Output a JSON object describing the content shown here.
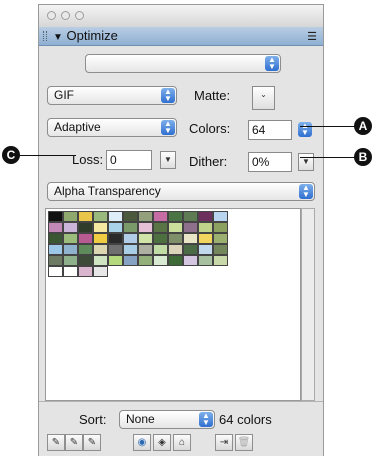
{
  "panel": {
    "tab_title": "Optimize",
    "menu_icon": "panel-menu-icon"
  },
  "settings": {
    "preset_value": "",
    "format_value": "GIF",
    "matte_label": "Matte:",
    "palette_value": "Adaptive",
    "colors_label": "Colors:",
    "colors_value": "64",
    "loss_label": "Loss:",
    "loss_value": "0",
    "dither_label": "Dither:",
    "dither_value": "0%",
    "transparency_value": "Alpha Transparency"
  },
  "callouts": {
    "a": "A",
    "b": "B",
    "c": "C"
  },
  "footer": {
    "sort_label": "Sort:",
    "sort_value": "None",
    "color_count": "64 colors"
  },
  "swatches": [
    [
      "#111111",
      "#8fa86e",
      "#e9c54a",
      "#9ab97c",
      "#ddeef6",
      "#4b5a3c",
      "#93a07b",
      "#c46ca3",
      "#4a7443",
      "#5e7b54",
      "#6d2f5d",
      "#b8d4ee"
    ],
    [
      "#c389b6",
      "#cbb5d8",
      "#2f3b2b",
      "#f3e7a1",
      "#a8d3e9",
      "#7a9a69",
      "#e6c0d6",
      "#5a7545",
      "#c9df9a",
      "#8e6f8c",
      "#bfd48a",
      "#8ca060"
    ],
    [
      "#3b5633",
      "#9bbc7b",
      "#b85b93",
      "#f0cc43",
      "#2a2a2a",
      "#b0cce6",
      "#d1e4a7",
      "#4e7040",
      "#7f8f6a",
      "#e8e6c6",
      "#f2d55f",
      "#9bb070"
    ],
    [
      "#9cc7e6",
      "#8fb3cf",
      "#5f8a5a",
      "#dcd7b0",
      "#6f6f6f",
      "#a8cfe5",
      "#aeb0a1",
      "#c1dca5",
      "#dad5ba",
      "#4a6b46",
      "#c2d8ec",
      "#74865c"
    ],
    [
      "#6c7b62",
      "#8eb08a",
      "#3e4a38",
      "#cfe5c2",
      "#b4d97c",
      "#86a3c3",
      "#94b07a",
      "#d8ead1",
      "#3e6a38",
      "#d4c6e0",
      "#a6c0a0",
      "#c8d8a8"
    ],
    [
      "#ffffff",
      "#ffffff",
      "#d9b6cd",
      "#e7e7e7",
      "",
      "",
      "",
      "",
      "",
      "",
      "",
      ""
    ]
  ],
  "icons": {
    "pos1": "eyedropper-add-icon",
    "pos2": "eyedropper-plus-icon",
    "pos3": "eyedropper-minus-icon",
    "web": "color-wheel-icon",
    "cube": "cube-icon",
    "lock": "lock-icon",
    "import": "import-icon",
    "trash": "trash-icon"
  }
}
